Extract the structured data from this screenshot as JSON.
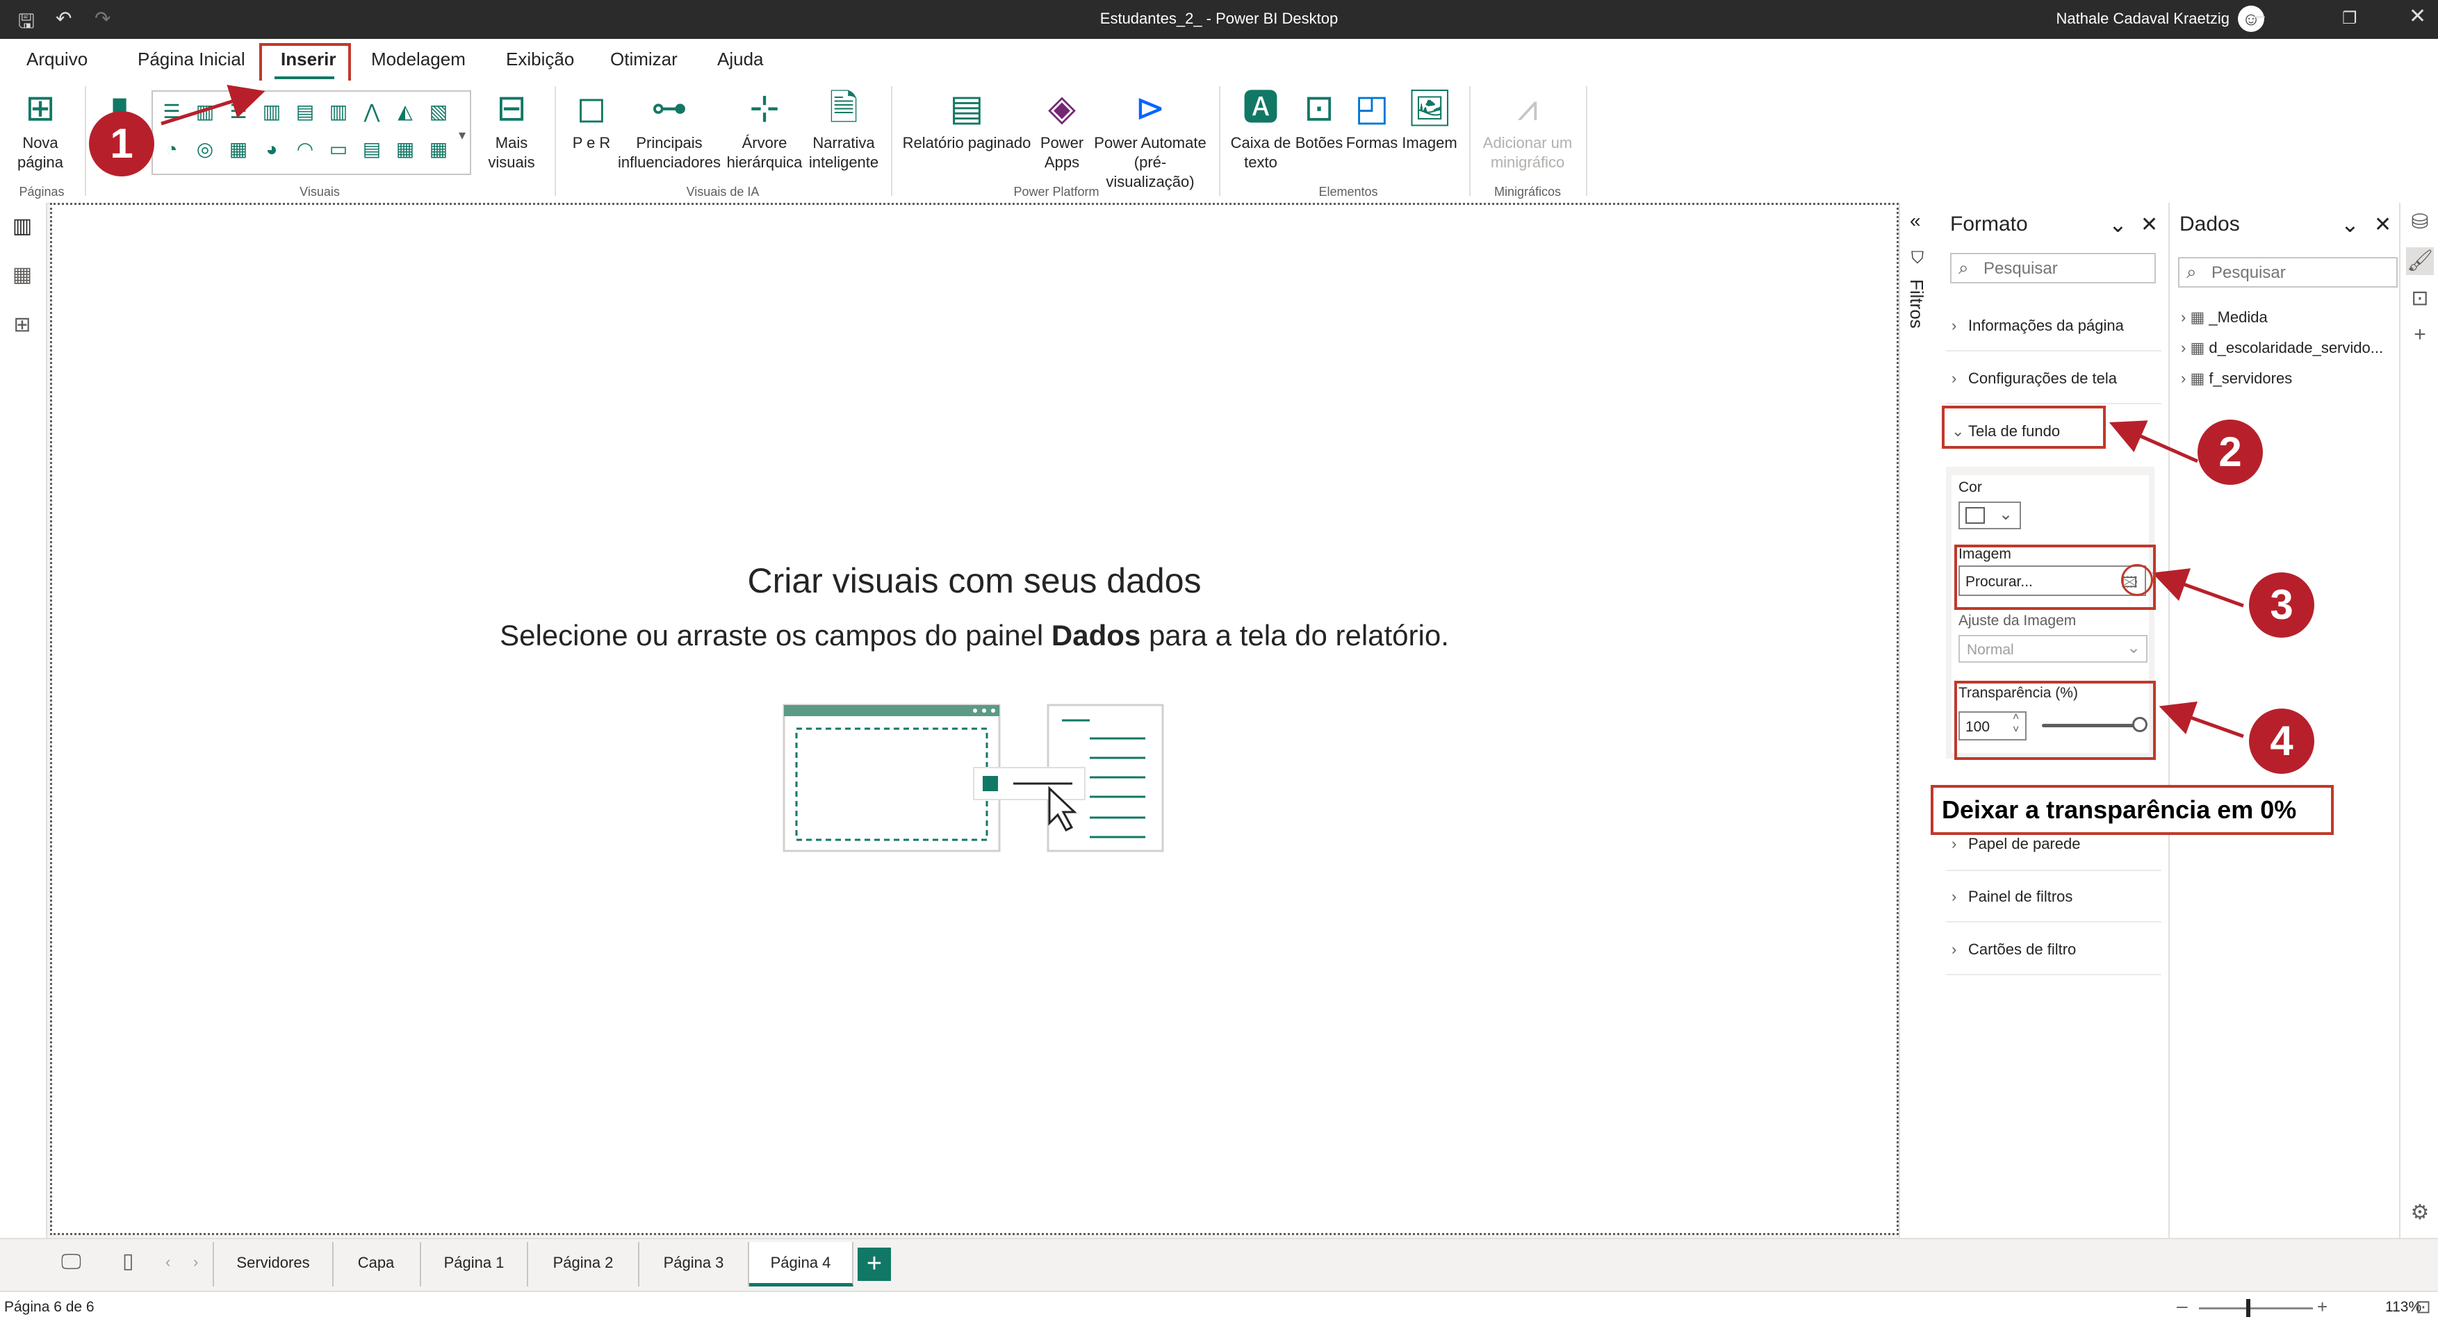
{
  "window": {
    "title": "Estudantes_2_ - Power BI Desktop",
    "user": "Nathale Cadaval Kraetzig"
  },
  "menu": {
    "tabs": [
      "Arquivo",
      "Página Inicial",
      "Inserir",
      "Modelagem",
      "Exibição",
      "Otimizar",
      "Ajuda"
    ],
    "active": "Inserir"
  },
  "ribbon": {
    "nova_pagina": "Nova página",
    "grp_paginas": "Páginas",
    "grp_visuais": "Visuais",
    "mais_visuais": "Mais visuais",
    "p_e_r": "P e R",
    "principais": "Principais influenciadores",
    "arvore": "Árvore hierárquica",
    "narrativa": "Narrativa inteligente",
    "grp_ia": "Visuais de IA",
    "relatorio": "Relatório paginado",
    "power_apps": "Power Apps",
    "power_automate": "Power Automate (pré-visualização)",
    "grp_pp": "Power Platform",
    "caixa": "Caixa de texto",
    "botoes": "Botões",
    "formas": "Formas",
    "imagem": "Imagem",
    "grp_elementos": "Elementos",
    "minigrafico": "Adicionar um minigráfico",
    "grp_mini": "Minigráficos"
  },
  "canvas": {
    "title": "Criar visuais com seus dados",
    "sub_before": "Selecione ou arraste os campos do painel ",
    "sub_bold": "Dados",
    "sub_after": " para a tela do relatório."
  },
  "filters": {
    "label": "Filtros"
  },
  "format_pane": {
    "title": "Formato",
    "search_placeholder": "Pesquisar",
    "sections": {
      "info": "Informações da página",
      "config": "Configurações de tela",
      "tela_fundo": "Tela de fundo",
      "papel": "Papel de parede",
      "painel_filtros": "Painel de filtros",
      "cartoes": "Cartões de filtro"
    },
    "cor_label": "Cor",
    "imagem_label": "Imagem",
    "procurar": "Procurar...",
    "ajuste_label": "Ajuste da Imagem",
    "ajuste_value": "Normal",
    "transparencia_label": "Transparência (%)",
    "transparencia_value": "100"
  },
  "data_pane": {
    "title": "Dados",
    "search_placeholder": "Pesquisar",
    "items": [
      "_Medida",
      "d_escolaridade_servido...",
      "f_servidores"
    ]
  },
  "pages": {
    "tabs": [
      "Servidores",
      "Capa",
      "Página 1",
      "Página 2",
      "Página 3",
      "Página 4"
    ],
    "active": "Página 4"
  },
  "status": {
    "page_info": "Página 6 de 6",
    "zoom": "113%"
  },
  "annotations": {
    "n1": "1",
    "n2": "2",
    "n3": "3",
    "n4": "4",
    "note": "Deixar a transparência em 0%",
    "color": "#b7202b"
  },
  "colors": {
    "accent": "#117865",
    "annotation": "#c0392b"
  }
}
